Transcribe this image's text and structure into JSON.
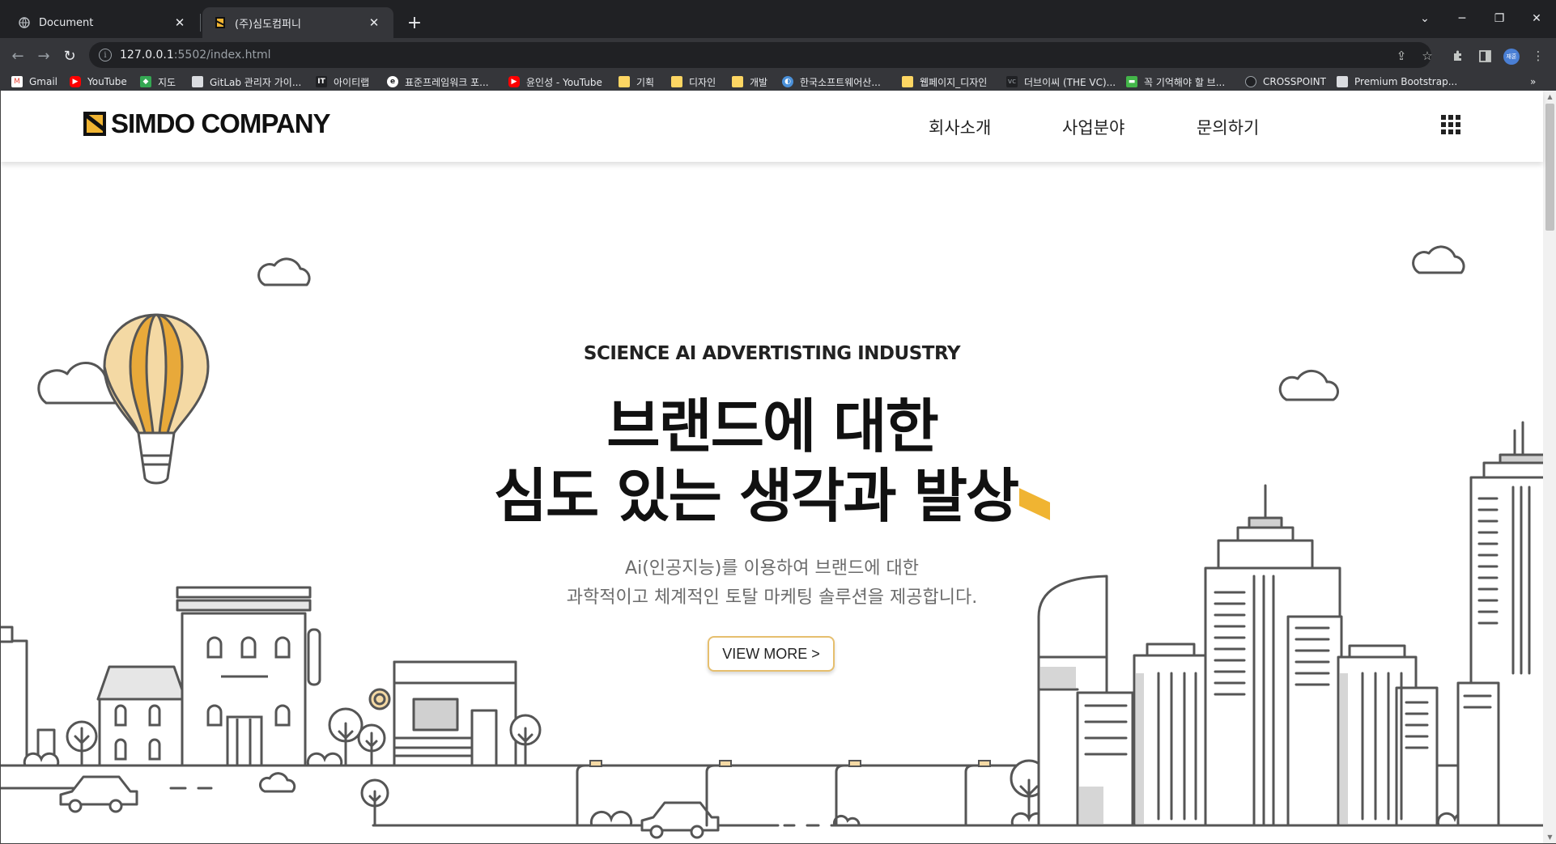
{
  "browser": {
    "tabs": [
      {
        "title": "Document",
        "active": false
      },
      {
        "title": "(주)심도컴퍼니",
        "active": true
      }
    ],
    "url_host": "127.0.0.1",
    "url_path": ":5502/index.html",
    "profile_label": "재훈",
    "bookmarks": [
      {
        "label": "Gmail",
        "icon": "gmail-icon",
        "color": "#ea4335"
      },
      {
        "label": "YouTube",
        "icon": "youtube-icon",
        "color": "#ff0000"
      },
      {
        "label": "지도",
        "icon": "maps-icon",
        "color": "#34a853"
      },
      {
        "label": "GitLab 관리자 가이...",
        "icon": "page-icon",
        "color": "#dadce0"
      },
      {
        "label": "아이티랩",
        "icon": "it-icon",
        "color": "#ffffff"
      },
      {
        "label": "표준프레임워크 포...",
        "icon": "e-icon",
        "color": "#ffffff"
      },
      {
        "label": "윤인성 - YouTube",
        "icon": "youtube-icon",
        "color": "#ff0000"
      },
      {
        "label": "기획",
        "icon": "folder-icon",
        "color": "#fdd663"
      },
      {
        "label": "디자인",
        "icon": "folder-icon",
        "color": "#fdd663"
      },
      {
        "label": "개발",
        "icon": "folder-icon",
        "color": "#fdd663"
      },
      {
        "label": "한국소프트웨어산...",
        "icon": "globe-icon",
        "color": "#4a90d9"
      },
      {
        "label": "웹페이지_디자인",
        "icon": "folder-icon",
        "color": "#fdd663"
      },
      {
        "label": "더브이씨 (THE VC)...",
        "icon": "vc-icon",
        "color": "#9aa0a6"
      },
      {
        "label": "꼭 기억해야 할 브...",
        "icon": "chat-icon",
        "color": "#43b649"
      },
      {
        "label": "CROSSPOINT",
        "icon": "crosspoint-icon",
        "color": "#9aa0a6"
      },
      {
        "label": "Premium Bootstrap...",
        "icon": "page-icon",
        "color": "#dadce0"
      }
    ],
    "bookmarks_overflow": "»"
  },
  "site": {
    "logo_text": "SIMDO COMPANY",
    "nav": [
      "회사소개",
      "사업분야",
      "문의하기"
    ],
    "hero": {
      "kicker": "SCIENCE AI ADVERTISTING INDUSTRY",
      "title_line1": "브랜드에 대한",
      "title_line2": "심도 있는 생각과 발상",
      "desc_line1": "Ai(인공지능)를 이용하여 브랜드에 대한",
      "desc_line2": "과학적이고 체계적인 토탈 마케팅 솔루션을 제공합니다.",
      "cta": "VIEW MORE >"
    },
    "colors": {
      "accent": "#f0b432",
      "balloon": "#e8a93a",
      "line": "#555555"
    }
  }
}
